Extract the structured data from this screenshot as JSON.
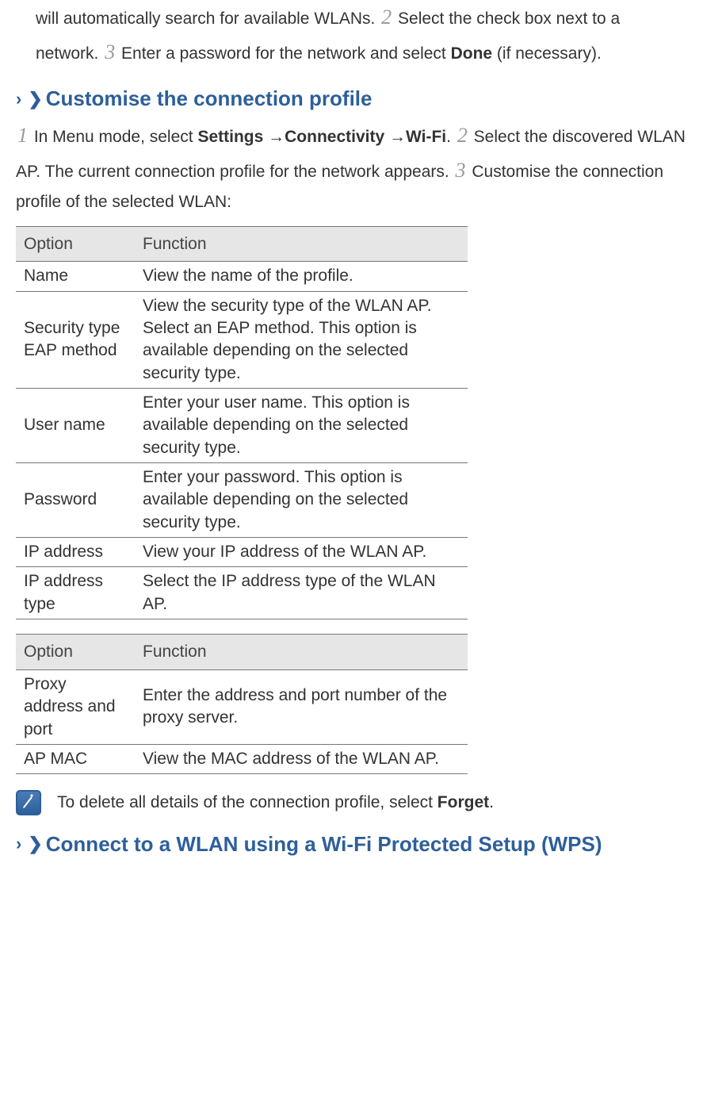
{
  "intro": {
    "text1": "will automatically search for available WLANs. ",
    "step2": "2",
    "text2": " Select the check box next to a network. ",
    "step3": "3",
    "text3": " Enter a password for the network and select ",
    "done": "Done",
    "text4": " (if necessary)."
  },
  "section1": {
    "heading": "Customise the connection profile",
    "step1": "1",
    "text1a": " In Menu mode, select ",
    "path1": "Settings",
    "arrow": " →",
    "path2": "Connectivity",
    "path3": "Wi-Fi",
    "text1b": ". ",
    "step2": "2",
    "text2": " Select the discovered WLAN AP. The current connection profile for the network appears. ",
    "step3": "3",
    "text3": " Customise the connection profile of the selected WLAN:"
  },
  "table1": {
    "h1": "Option",
    "h2": "Function",
    "rows": [
      {
        "opt": "Name",
        "fn": "View the name of the profile."
      },
      {
        "opt": "Security type EAP method",
        "fn": "View the security type of the WLAN AP. Select an EAP method. This option is available depending on the selected security type."
      },
      {
        "opt": "User name",
        "fn": "Enter your user name. This option is available depending on the selected security type."
      },
      {
        "opt": "Password",
        "fn": "Enter your password. This option is available depending on the selected security type."
      },
      {
        "opt": "IP address",
        "fn": "View your IP address of the WLAN AP."
      },
      {
        "opt": "IP address type",
        "fn": "Select the IP address type of the WLAN AP."
      }
    ]
  },
  "table2": {
    "h1": "Option",
    "h2": "Function",
    "rows": [
      {
        "opt": "Proxy address and port",
        "fn": "Enter the address and port number of the proxy server."
      },
      {
        "opt": "AP MAC",
        "fn": "View the MAC address of the WLAN AP."
      }
    ]
  },
  "note": {
    "text": "To delete all details of the connection profile, select ",
    "bold": "Forget",
    "tail": "."
  },
  "section2": {
    "heading": "Connect to a WLAN using a Wi-Fi Protected Setup (WPS)"
  }
}
